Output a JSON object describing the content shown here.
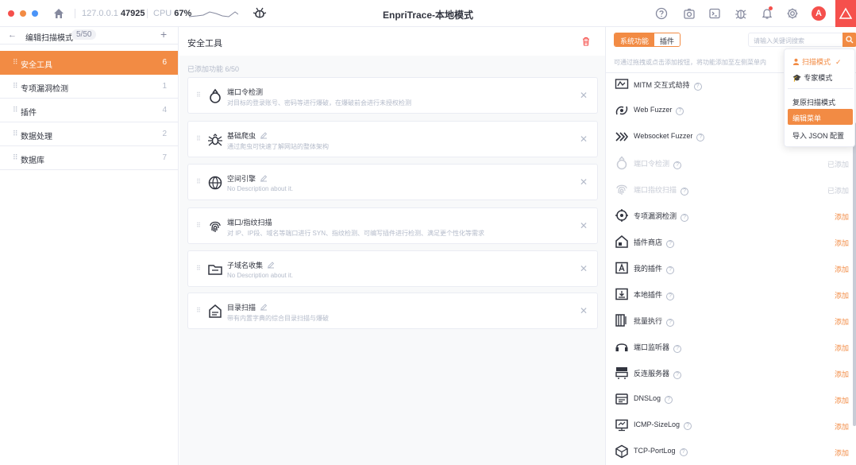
{
  "titlebar": {
    "host_prefix": "127.0.0.1",
    "host_port": "47925",
    "cpu_label": "CPU",
    "cpu_value": "67%",
    "app_title": "EnpriTrace-本地模式"
  },
  "sidebar": {
    "back_icon": "arrow-left-icon",
    "title": "编辑扫描模式",
    "count": "5/50",
    "add_label": "+",
    "items": [
      {
        "label": "安全工具",
        "count": "6",
        "active": true
      },
      {
        "label": "专项漏洞检测",
        "count": "1",
        "active": false
      },
      {
        "label": "插件",
        "count": "4",
        "active": false
      },
      {
        "label": "数据处理",
        "count": "2",
        "active": false
      },
      {
        "label": "数据库",
        "count": "7",
        "active": false
      }
    ]
  },
  "center": {
    "title": "安全工具",
    "added": "已添加功能 6/50",
    "cards": [
      {
        "title": "端口令检测",
        "desc": "对目标的登录账号、密码等进行爆破，在爆破前会进行未授权检测",
        "editable": false,
        "icon": "lock-icon"
      },
      {
        "title": "基础爬虫",
        "desc": "通过爬虫可快速了解网站的整体架构",
        "editable": true,
        "icon": "spider-icon"
      },
      {
        "title": "空间引擎",
        "desc": "No Description about it.",
        "editable": true,
        "icon": "globe-icon"
      },
      {
        "title": "端口/指纹扫描",
        "desc": "对 IP、IP段、域名等端口进行 SYN、指纹检测、可编写插件进行检测、满足更个性化等需求",
        "editable": false,
        "icon": "fingerprint-icon"
      },
      {
        "title": "子域名收集",
        "desc": "No Description about it.",
        "editable": true,
        "icon": "folder-icon"
      },
      {
        "title": "目录扫描",
        "desc": "带有内置字典的综合目录扫描与爆破",
        "editable": true,
        "icon": "directory-icon"
      }
    ]
  },
  "right": {
    "tab_system": "系统功能",
    "tab_plugin": "插件",
    "search_placeholder": "请输入关键词搜索",
    "hint": "可通过拖拽或点击添加按钮，将功能添加至左侧菜单内",
    "added_label": "已添加",
    "add_label": "添加",
    "plugins": [
      {
        "name": "MITM 交互式劫持",
        "state": "hidden",
        "icon": "mitm-icon"
      },
      {
        "name": "Web Fuzzer",
        "state": "hidden",
        "icon": "fuzzer-icon"
      },
      {
        "name": "Websocket Fuzzer",
        "state": "hidden",
        "icon": "websocket-icon"
      },
      {
        "name": "端口令检测",
        "state": "added",
        "icon": "lock-icon"
      },
      {
        "name": "端口指纹扫描",
        "state": "added",
        "icon": "fingerprint-icon"
      },
      {
        "name": "专项漏洞检测",
        "state": "add",
        "icon": "target-icon"
      },
      {
        "name": "插件商店",
        "state": "add",
        "icon": "store-icon"
      },
      {
        "name": "我的插件",
        "state": "add",
        "icon": "my-plugin-icon"
      },
      {
        "name": "本地插件",
        "state": "add",
        "icon": "local-plugin-icon"
      },
      {
        "name": "批量执行",
        "state": "add",
        "icon": "batch-icon"
      },
      {
        "name": "端口监听器",
        "state": "add",
        "icon": "headset-icon"
      },
      {
        "name": "反连服务器",
        "state": "add",
        "icon": "server-icon"
      },
      {
        "name": "DNSLog",
        "state": "add",
        "icon": "dnslog-icon"
      },
      {
        "name": "ICMP-SizeLog",
        "state": "add",
        "icon": "icmp-icon"
      },
      {
        "name": "TCP-PortLog",
        "state": "add",
        "icon": "tcp-icon"
      }
    ]
  },
  "dropdown": {
    "scan_mode": "扫描模式",
    "expert_mode": "专家模式",
    "reset": "复原扫描模式",
    "edit_menu": "编辑菜单",
    "import_json": "导入 JSON 配置"
  },
  "colors": {
    "accent": "#f28b44",
    "danger": "#f5504c",
    "text": "#31343f",
    "muted": "#b4bbca"
  }
}
